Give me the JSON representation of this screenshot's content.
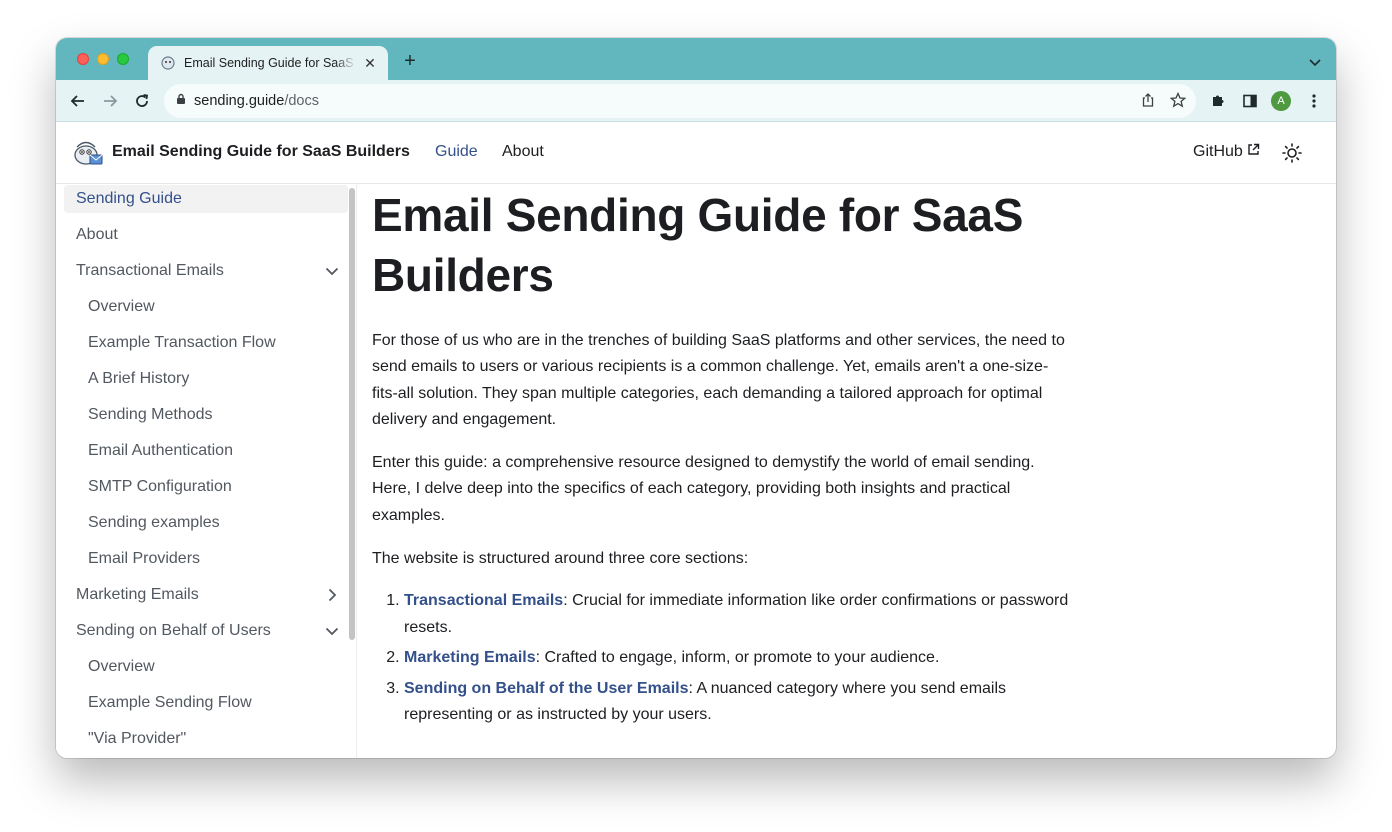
{
  "browser": {
    "tab_title": "Email Sending Guide for SaaS Builders",
    "tab_close": "✕",
    "new_tab": "+",
    "url_domain": "sending.guide",
    "url_path": "/docs",
    "avatar_letter": "A",
    "accent_color": "#62b6be"
  },
  "header": {
    "site_title": "Email Sending Guide for SaaS Builders",
    "nav": [
      "Guide",
      "About"
    ],
    "github": "GitHub"
  },
  "sidebar": {
    "items": [
      {
        "label": "Sending Guide",
        "active": true
      },
      {
        "label": "About"
      },
      {
        "label": "Transactional Emails",
        "caret": "down"
      },
      {
        "label": "Overview"
      },
      {
        "label": "Example Transaction Flow"
      },
      {
        "label": "A Brief History"
      },
      {
        "label": "Sending Methods"
      },
      {
        "label": "Email Authentication"
      },
      {
        "label": "SMTP Configuration"
      },
      {
        "label": "Sending examples"
      },
      {
        "label": "Email Providers"
      },
      {
        "label": "Marketing Emails",
        "caret": "right"
      },
      {
        "label": "Sending on Behalf of Users",
        "caret": "down"
      },
      {
        "label": "Overview"
      },
      {
        "label": "Example Sending Flow"
      },
      {
        "label": "\"Via Provider\""
      }
    ]
  },
  "main": {
    "title": "Email Sending Guide for SaaS Builders",
    "paragraphs": [
      "For those of us who are in the trenches of building SaaS platforms and other services, the need to send emails to users or various recipients is a common challenge. Yet, emails aren't a one-size-fits-all solution. They span multiple categories, each demanding a tailored approach for optimal delivery and engagement.",
      "Enter this guide: a comprehensive resource designed to demystify the world of email sending. Here, I delve deep into the specifics of each category, providing both insights and practical examples.",
      "The website is structured around three core sections:"
    ],
    "sections": [
      {
        "link": "Transactional Emails",
        "text": ": Crucial for immediate information like order confirmations or password resets."
      },
      {
        "link": "Marketing Emails",
        "text": ": Crafted to engage, inform, or promote to your audience."
      },
      {
        "link": "Sending on Behalf of the User Emails",
        "text": ": A nuanced category where you send emails representing or as instructed by your users."
      }
    ]
  }
}
